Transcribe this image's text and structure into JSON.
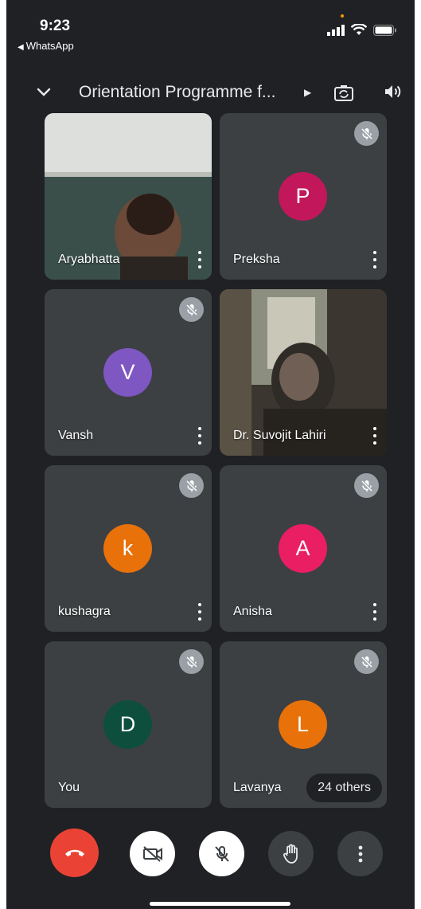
{
  "status_bar": {
    "time": "9:23",
    "back_app": "WhatsApp",
    "icons": [
      "signal-icon",
      "wifi-icon",
      "battery-icon"
    ]
  },
  "meeting": {
    "title": "Orientation Programme f...",
    "icons": [
      "chevron-down-icon",
      "switch-camera-icon",
      "speaker-icon"
    ]
  },
  "tiles": [
    {
      "name": "Aryabhatta",
      "type": "video",
      "muted": false
    },
    {
      "name": "Preksha",
      "initial": "P",
      "color": "#c2185b",
      "muted": true
    },
    {
      "name": "Vansh",
      "initial": "V",
      "color": "#7e57c2",
      "muted": true
    },
    {
      "name": "Dr. Suvojit Lahiri",
      "type": "video",
      "muted": false
    },
    {
      "name": "kushagra",
      "initial": "k",
      "color": "#e8710a",
      "muted": true
    },
    {
      "name": "Anisha",
      "initial": "A",
      "color": "#e91e63",
      "muted": true
    },
    {
      "name": "You",
      "initial": "D",
      "color": "#0d4f3c",
      "muted": true
    },
    {
      "name": "Lavanya",
      "initial": "L",
      "color": "#e8710a",
      "muted": true,
      "badge": "24 others"
    }
  ],
  "controls": {
    "end_call_color": "#ea4335",
    "buttons": [
      "end-call-button",
      "camera-off-button",
      "mic-off-button",
      "raise-hand-button",
      "more-options-button"
    ]
  }
}
